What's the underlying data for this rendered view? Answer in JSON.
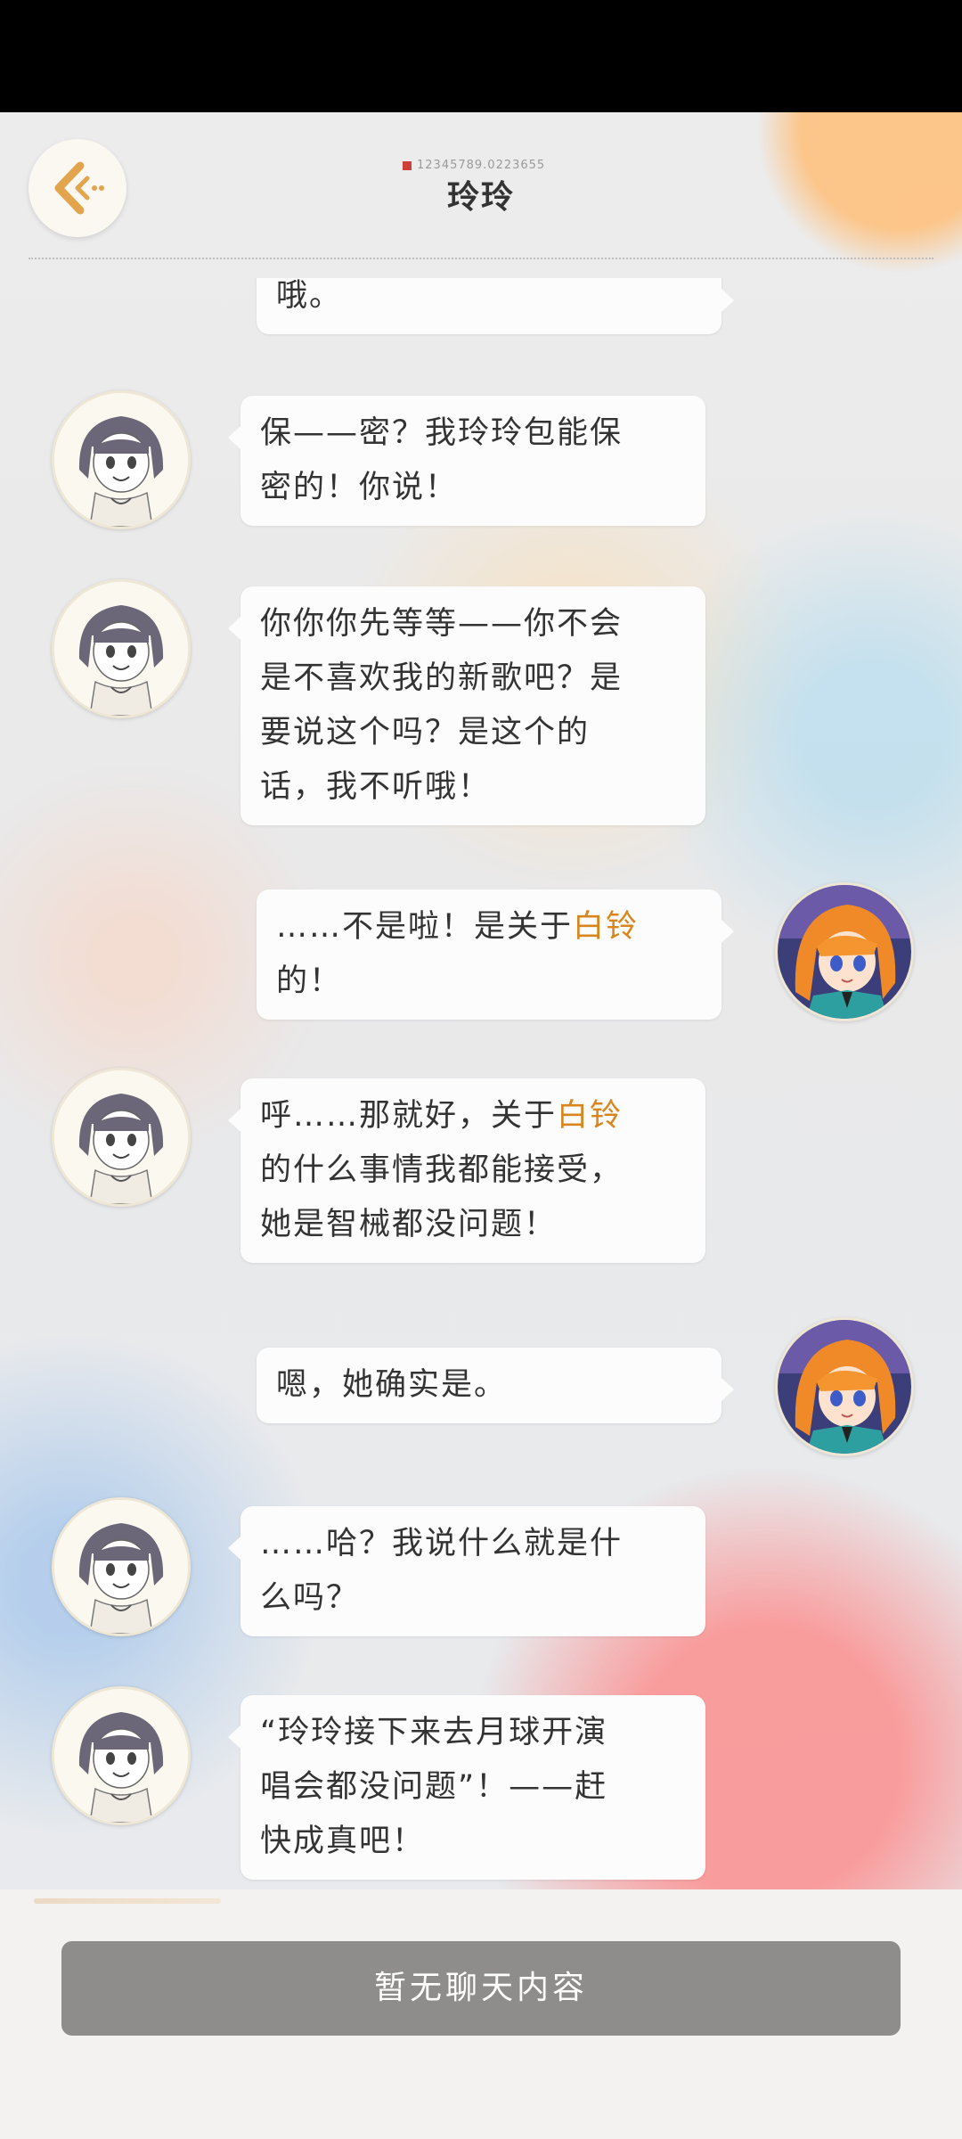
{
  "header": {
    "id_text": "12345789.0223655",
    "title": "玲玲"
  },
  "messages": [
    {
      "side": "right",
      "avatar": "orange-haired-girl-avatar",
      "lines": [
        "哦。"
      ]
    },
    {
      "side": "left",
      "avatar": "lingling-sketch-avatar",
      "lines": [
        "保——密？我玲玲包能保",
        "密的！你说！"
      ]
    },
    {
      "side": "left",
      "avatar": "lingling-sketch-avatar",
      "lines": [
        "你你你先等等——你不会",
        "是不喜欢我的新歌吧？是",
        "要说这个吗？是这个的",
        "话，我不听哦！"
      ]
    },
    {
      "side": "right",
      "avatar": "orange-haired-girl-avatar",
      "lines": [
        "……不是啦！是关于",
        "白铃",
        "的！"
      ]
    },
    {
      "side": "left",
      "avatar": "lingling-sketch-avatar",
      "lines": [
        "呼……那就好，关于",
        "白铃",
        "的什么事情我都能接受，",
        "她是智械都没问题！"
      ]
    },
    {
      "side": "right",
      "avatar": "orange-haired-girl-avatar",
      "lines": [
        "嗯，她确实是。"
      ]
    },
    {
      "side": "left",
      "avatar": "lingling-sketch-avatar",
      "lines": [
        "……哈？我说什么就是什",
        "么吗？"
      ]
    },
    {
      "side": "left",
      "avatar": "lingling-sketch-avatar",
      "lines": [
        "“玲玲接下来去月球开演",
        "唱会都没问题”！——赶",
        "快成真吧！"
      ]
    }
  ],
  "input": {
    "placeholder": "暂无聊天内容"
  },
  "colors": {
    "highlight": "#d9851e",
    "bubble": "#fcfcfc",
    "input_bar": "#8e8d8b"
  }
}
